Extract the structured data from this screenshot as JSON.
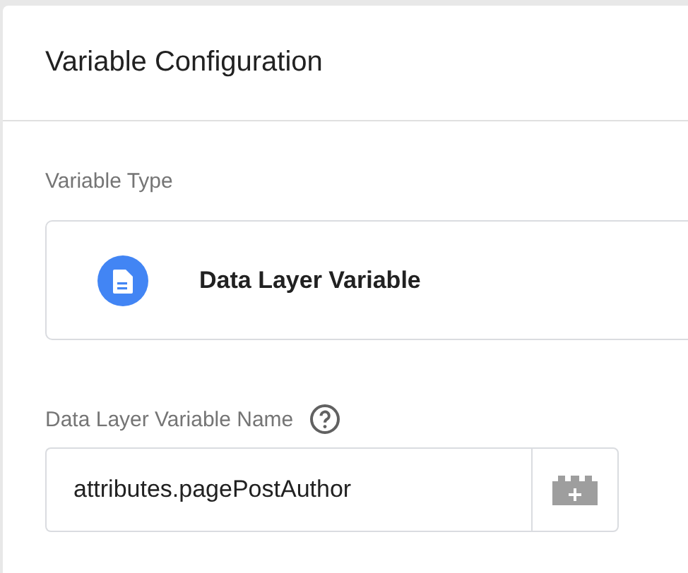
{
  "panel": {
    "title": "Variable Configuration"
  },
  "variable_type": {
    "label": "Variable Type",
    "name": "Data Layer Variable"
  },
  "name_field": {
    "label": "Data Layer Variable Name",
    "value": "attributes.pagePostAuthor"
  }
}
